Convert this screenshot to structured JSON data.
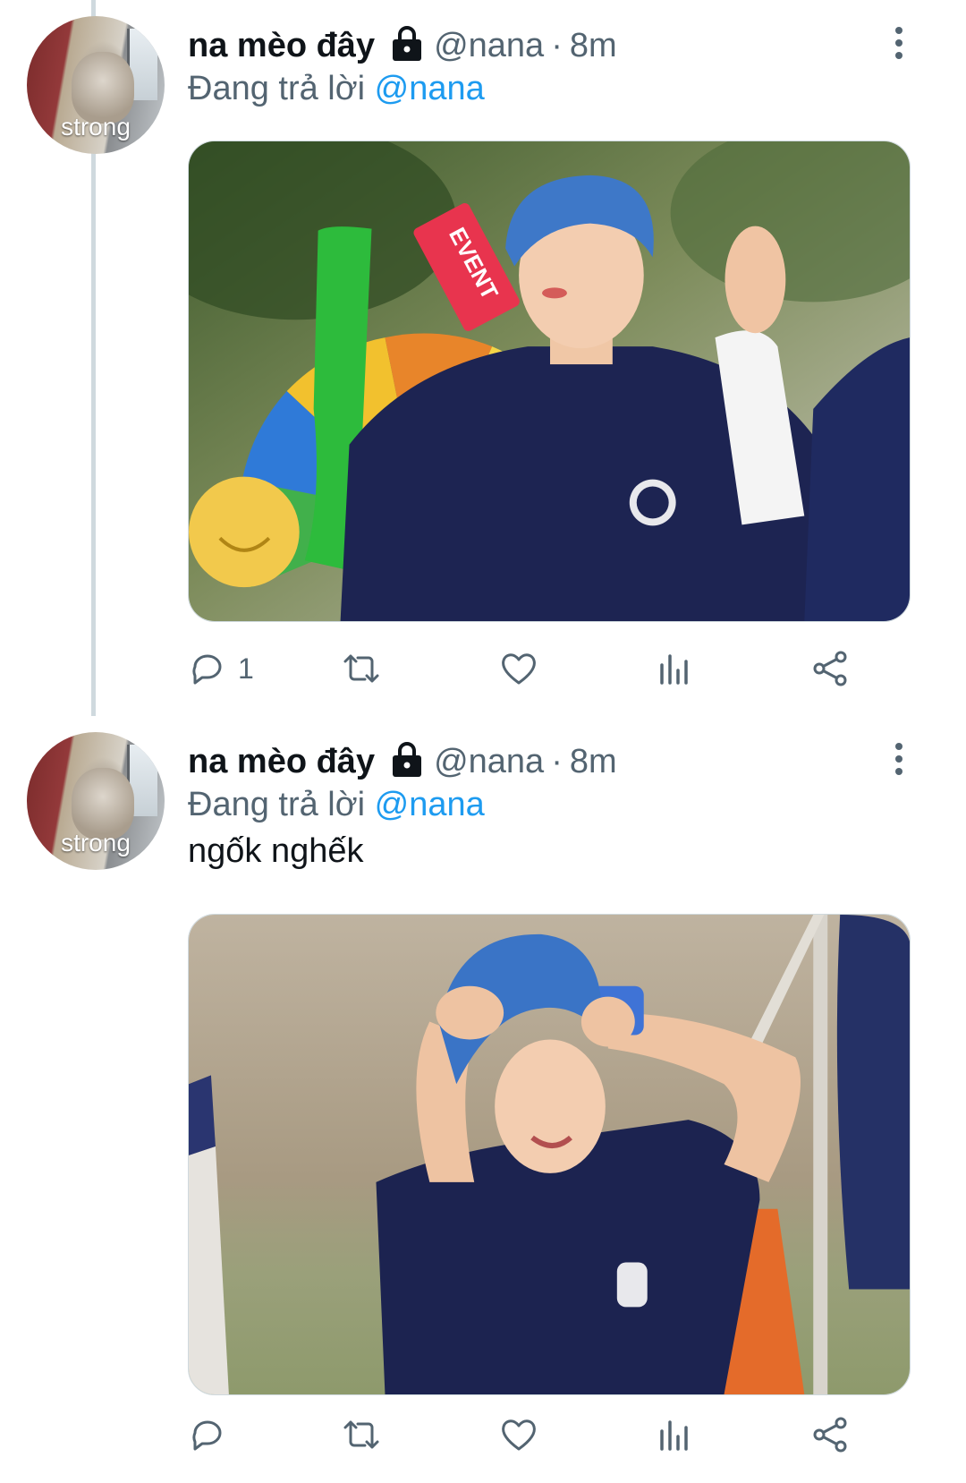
{
  "tweets": [
    {
      "author": {
        "display_name": "na mèo đây",
        "handle": "@nana",
        "avatar_caption": "strong"
      },
      "timestamp": "8m",
      "reply_prefix": "Đang trả lời",
      "reply_to": "@nana",
      "text": "",
      "media_description_icon": "photo",
      "media_sign_text": "EVENT",
      "reply_count": "1",
      "icons": [
        "lock-icon",
        "more-icon",
        "reply-icon",
        "retweet-icon",
        "like-icon",
        "views-icon",
        "share-icon"
      ]
    },
    {
      "author": {
        "display_name": "na mèo đây",
        "handle": "@nana",
        "avatar_caption": "strong"
      },
      "timestamp": "8m",
      "reply_prefix": "Đang trả lời",
      "reply_to": "@nana",
      "text": "ngốk nghếk",
      "media_description_icon": "photo",
      "reply_count": "",
      "icons": [
        "lock-icon",
        "more-icon",
        "reply-icon",
        "retweet-icon",
        "like-icon",
        "views-icon",
        "share-icon"
      ]
    }
  ],
  "colors": {
    "link": "#1d9bf0",
    "secondary_text": "#536471",
    "primary_text": "#0f1419",
    "thread_line": "#cfd9de"
  }
}
